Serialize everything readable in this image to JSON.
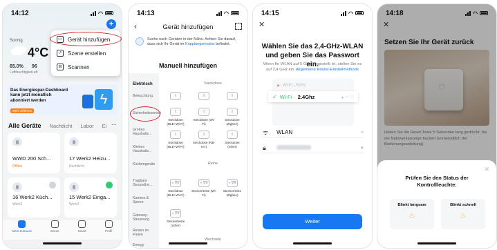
{
  "colors": {
    "accent": "#1877f2",
    "highlight_ring": "#d61f26",
    "online": "#2ecc71",
    "warning": "#f5821f"
  },
  "phone1": {
    "time": "14:12",
    "weather": {
      "city": "Sonnig",
      "temp": "4°C",
      "stats": [
        {
          "value": "65.0%",
          "label": "Luftfeuchtigkei"
        },
        {
          "value": "96",
          "label": "Luft"
        }
      ]
    },
    "menu": [
      {
        "icon": "add-device-icon",
        "label": "Gerät hinzufügen"
      },
      {
        "icon": "scene-icon",
        "label": "Szene erstellen"
      },
      {
        "icon": "scan-icon",
        "label": "Scannen"
      }
    ],
    "banner": {
      "title": "Das Energiespar-Dashboard kann jetzt monatlich abonniert werden",
      "button": "Mehr erfahren"
    },
    "tabs": [
      "Alle Geräte",
      "Nachtlicht",
      "Labor",
      "Ei"
    ],
    "devices": [
      {
        "name": "",
        "sub": "",
        "on": false
      },
      {
        "name": "",
        "sub": "",
        "on": false
      },
      {
        "name": "WWD 200 Sch...",
        "sub": "Offline",
        "on": false
      },
      {
        "name": "17 Werk2 Heizu...",
        "sub": "Nachtlicht",
        "on": false
      },
      {
        "name": "16 Werk2 Küch...",
        "sub": "Werk2",
        "on": false
      },
      {
        "name": "15 Werk2 Einga...",
        "sub": "Werk2",
        "on": true
      }
    ],
    "nav": [
      "Mein Zuhause",
      "Szene",
      "Smart",
      "Profil"
    ]
  },
  "phone2": {
    "time": "14:13",
    "title": "Gerät hinzufügen",
    "info": "Suche nach Geräten in der Nähe. Achten Sie darauf, dass sich Ihr Gerät im",
    "info_link": "Kopplungsmodus",
    "info_end": "befindet.",
    "manual": "Manuell hinzufügen",
    "categories": [
      "Elektrisch",
      "Beleuchtung",
      "Sicherheitssensor",
      "Großes Haushalts...",
      "Kleines Haushalts...",
      "Küchengeräte",
      "Tragbare Gesundhe...",
      "Kamera & Sperre",
      "Gateway-Steuerung",
      "Reisen im Freien",
      "Energy"
    ],
    "headers": [
      "Steckdose",
      "Reihe",
      "Wechseln"
    ],
    "plugs_row1": [
      "Steckdose (BLE+Wi-Fi)",
      "Steckdose (Wi-Fi)",
      "Steckdose (Zigbee)"
    ],
    "plugs_row2": [
      "Steckdose (BLE+Wi-Fi)",
      "Steckdose (NB-IoT)",
      "Steckdose (other)"
    ],
    "plugs_row3": [
      "Steckdose (BLE+Wi-Fi)",
      "Steckerleiste (Wi-Fi)",
      "Steckerleiste (Zigbee)"
    ],
    "plugs_row4": [
      "Steckerleiste (other)"
    ]
  },
  "phone3": {
    "time": "14:15",
    "title": "Wählen Sie das 2,4-GHz-WLAN und geben Sie das Passwort ein.",
    "sub": "Wenn Ihr WLAN auf 5 GHz eingestellt ist, stellen Sie es auf 2,4 GHz ein.",
    "sub_link": "Allgemeine Router-Einstellmethode",
    "wifi_bad": "Wi-Fi - 5Ghz",
    "wifi_good_prefix": "Wi-Fi - ",
    "wifi_good": "2.4Ghz",
    "wlan_label": "WLAN",
    "button": "Weiter"
  },
  "phone4": {
    "time": "14:18",
    "title": "Setzen Sie Ihr Gerät zurück",
    "desc": "Halten Sie die Reset-Taste 5 Sekunden lang gedrückt, bis die Netzwerkanzeige flackert (vorbehaltlich der Bedienungsanleitung).",
    "sheet_title": "Prüfen Sie den Status der Kontrollleuchte:",
    "options": [
      "Blinkt langsam",
      "Blinkt schnell"
    ]
  }
}
